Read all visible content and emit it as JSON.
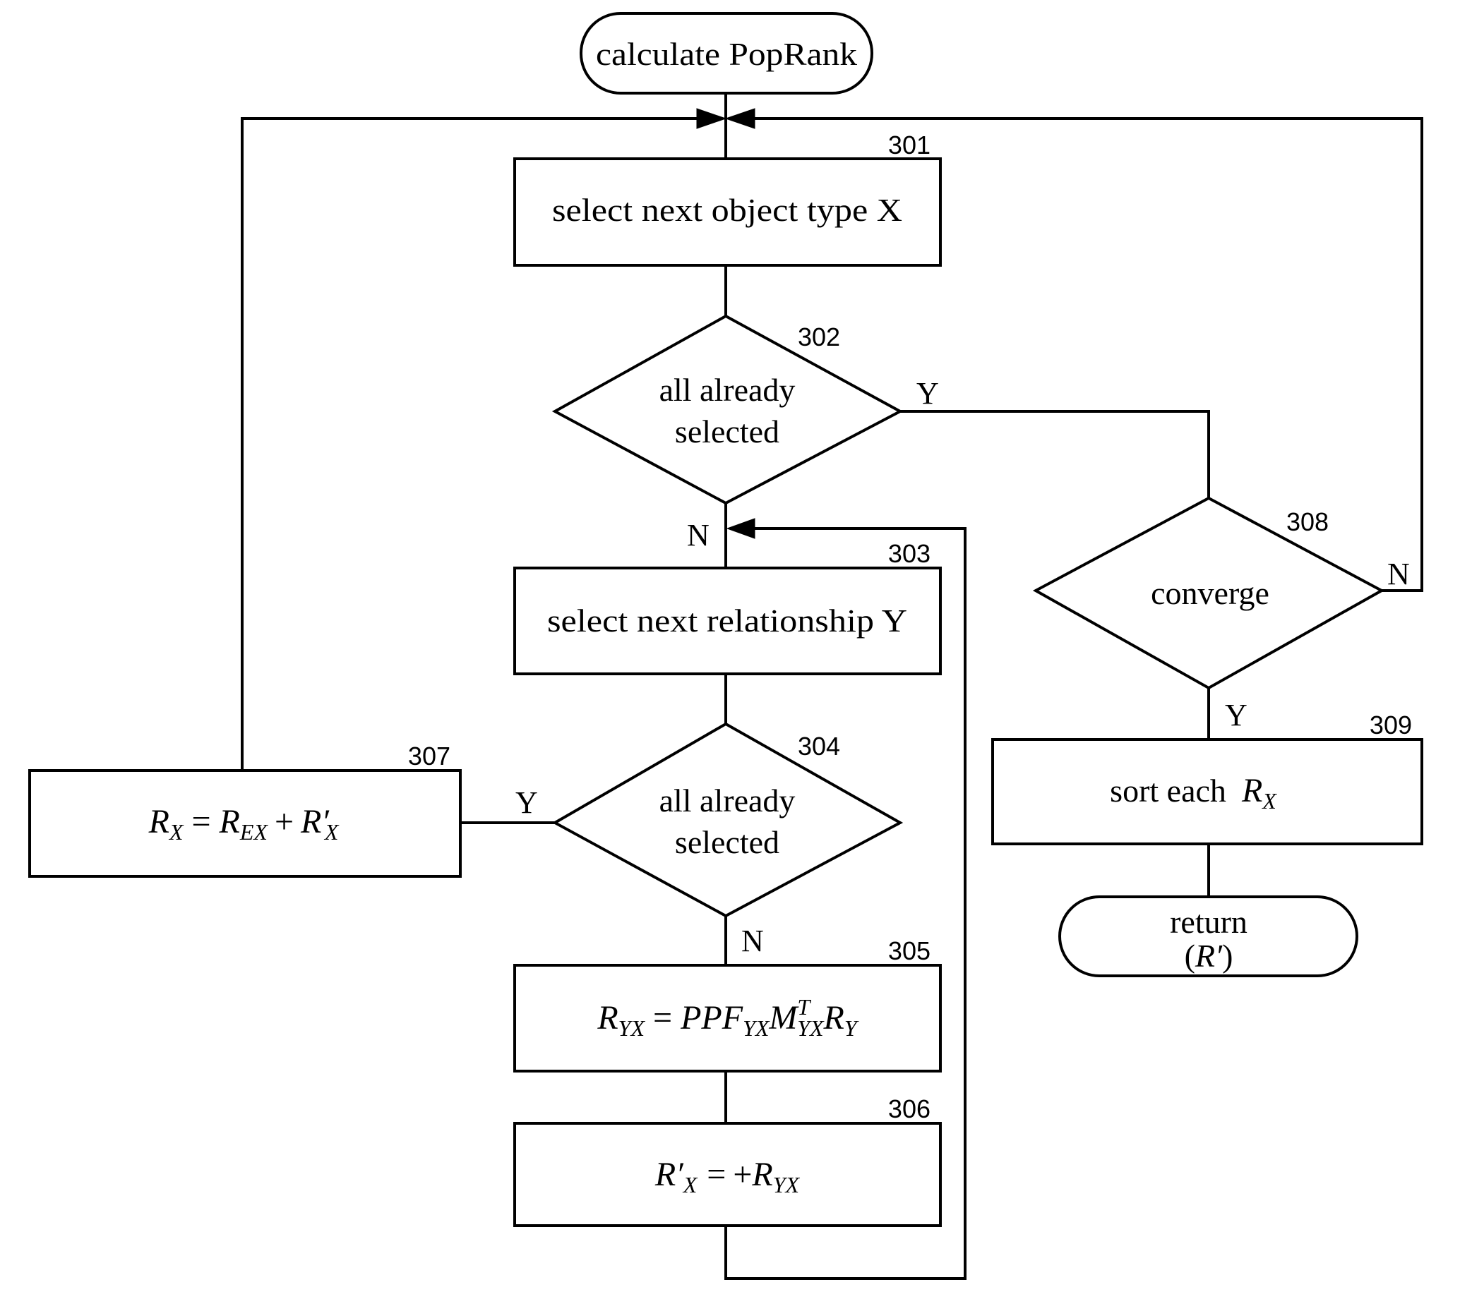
{
  "diagram": {
    "title": "calculate PopRank",
    "nodes": {
      "start": {
        "type": "terminator",
        "label": "calculate PopRank"
      },
      "n301": {
        "type": "process",
        "ref": "301",
        "label": "select next object type X"
      },
      "n302": {
        "type": "decision",
        "ref": "302",
        "line1": "all already",
        "line2": "selected"
      },
      "n303": {
        "type": "process",
        "ref": "303",
        "label": "select next relationship Y"
      },
      "n304": {
        "type": "decision",
        "ref": "304",
        "line1": "all already",
        "line2": "selected"
      },
      "n305": {
        "type": "process",
        "ref": "305",
        "formula": {
          "lhs": "R",
          "lhs_sub": "YX",
          "eq": "=",
          "t1": "PPF",
          "t1_sub": "YX",
          "t2": "M",
          "t2_sup": "T",
          "t2_sub": "YX",
          "t3": "R",
          "t3_sub": "Y"
        }
      },
      "n306": {
        "type": "process",
        "ref": "306",
        "formula": {
          "lhs": "R′",
          "lhs_sub": "X",
          "eq": "=",
          "op": "+",
          "t1": "R",
          "t1_sub": "YX"
        }
      },
      "n307": {
        "type": "process",
        "ref": "307",
        "formula": {
          "lhs": "R",
          "lhs_sub": "X",
          "eq": "=",
          "t1": "R",
          "t1_sub": "EX",
          "op": "+",
          "t2": "R′",
          "t2_sub": "X"
        }
      },
      "n308": {
        "type": "decision",
        "ref": "308",
        "label": "converge"
      },
      "n309": {
        "type": "process",
        "ref": "309",
        "label": "sort each",
        "math": "R",
        "math_sub": "X"
      },
      "end": {
        "type": "terminator",
        "line1": "return",
        "paren_open": "(",
        "math": "R′",
        "paren_close": ")"
      }
    },
    "edge_labels": {
      "n302_yes": "Y",
      "n302_no": "N",
      "n304_yes": "Y",
      "n304_no": "N",
      "n308_yes": "Y",
      "n308_no": "N"
    },
    "edges": [
      {
        "from": "start",
        "to": "n301"
      },
      {
        "from": "n301",
        "to": "n302"
      },
      {
        "from": "n302",
        "to": "n308",
        "label": "Y"
      },
      {
        "from": "n302",
        "to": "n303",
        "label": "N"
      },
      {
        "from": "n303",
        "to": "n304"
      },
      {
        "from": "n304",
        "to": "n307",
        "label": "Y"
      },
      {
        "from": "n304",
        "to": "n305",
        "label": "N"
      },
      {
        "from": "n305",
        "to": "n306"
      },
      {
        "from": "n306",
        "to": "n303"
      },
      {
        "from": "n307",
        "to": "n301"
      },
      {
        "from": "n308",
        "to": "n301",
        "label": "N"
      },
      {
        "from": "n308",
        "to": "n309",
        "label": "Y"
      },
      {
        "from": "n309",
        "to": "end"
      }
    ]
  }
}
